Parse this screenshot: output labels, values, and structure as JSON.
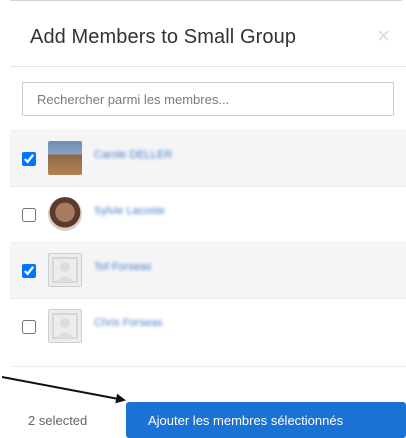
{
  "modal": {
    "title": "Add Members to Small Group",
    "close_symbol": "×"
  },
  "search": {
    "placeholder": "Rechercher parmi les membres..."
  },
  "members": [
    {
      "name": "Carole DELLER",
      "checked": true,
      "avatar": "photo"
    },
    {
      "name": "Sylvie Lacoste",
      "checked": false,
      "avatar": "photo"
    },
    {
      "name": "Tof Forseas",
      "checked": true,
      "avatar": "placeholder"
    },
    {
      "name": "Chris Forseas",
      "checked": false,
      "avatar": "placeholder"
    }
  ],
  "footer": {
    "selected_count": "2 selected",
    "add_button_label": "Ajouter les membres sélectionnés"
  },
  "colors": {
    "primary": "#1a73d4",
    "member_link": "#4a7fcf"
  },
  "icons": {
    "close": "close-icon",
    "avatar_placeholder": "user-placeholder-icon",
    "annotation": "arrow-icon"
  }
}
